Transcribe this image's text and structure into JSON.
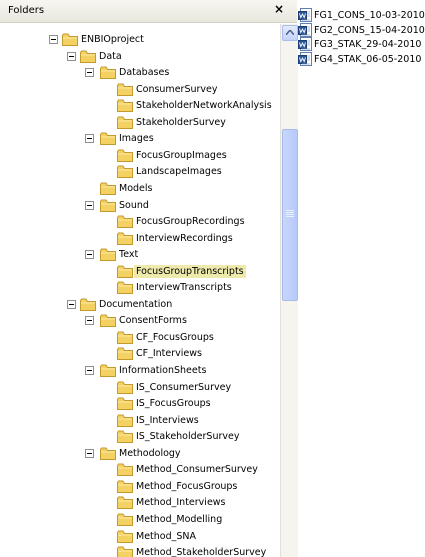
{
  "folders_pane": {
    "title": "Folders",
    "close_label": "×"
  },
  "tree": [
    {
      "label": "ENBIOproject",
      "depth": 0,
      "expanded": true
    },
    {
      "label": "Data",
      "depth": 1,
      "expanded": true
    },
    {
      "label": "Databases",
      "depth": 2,
      "expanded": true
    },
    {
      "label": "ConsumerSurvey",
      "depth": 3
    },
    {
      "label": "StakeholderNetworkAnalysis",
      "depth": 3
    },
    {
      "label": "StakeholderSurvey",
      "depth": 3
    },
    {
      "label": "Images",
      "depth": 2,
      "expanded": true
    },
    {
      "label": "FocusGroupImages",
      "depth": 3
    },
    {
      "label": "LandscapeImages",
      "depth": 3
    },
    {
      "label": "Models",
      "depth": 2
    },
    {
      "label": "Sound",
      "depth": 2,
      "expanded": true
    },
    {
      "label": "FocusGroupRecordings",
      "depth": 3
    },
    {
      "label": "InterviewRecordings",
      "depth": 3
    },
    {
      "label": "Text",
      "depth": 2,
      "expanded": true
    },
    {
      "label": "FocusGroupTranscripts",
      "depth": 3,
      "selected": true
    },
    {
      "label": "InterviewTranscripts",
      "depth": 3
    },
    {
      "label": "Documentation",
      "depth": 1,
      "expanded": true
    },
    {
      "label": "ConsentForms",
      "depth": 2,
      "expanded": true
    },
    {
      "label": "CF_FocusGroups",
      "depth": 3
    },
    {
      "label": "CF_Interviews",
      "depth": 3
    },
    {
      "label": "InformationSheets",
      "depth": 2,
      "expanded": true
    },
    {
      "label": "IS_ConsumerSurvey",
      "depth": 3
    },
    {
      "label": "IS_FocusGroups",
      "depth": 3
    },
    {
      "label": "IS_Interviews",
      "depth": 3
    },
    {
      "label": "IS_StakeholderSurvey",
      "depth": 3
    },
    {
      "label": "Methodology",
      "depth": 2,
      "expanded": true
    },
    {
      "label": "Method_ConsumerSurvey",
      "depth": 3
    },
    {
      "label": "Method_FocusGroups",
      "depth": 3
    },
    {
      "label": "Method_Interviews",
      "depth": 3
    },
    {
      "label": "Method_Modelling",
      "depth": 3
    },
    {
      "label": "Method_SNA",
      "depth": 3
    },
    {
      "label": "Method_StakeholderSurvey",
      "depth": 3
    }
  ],
  "files": [
    {
      "name": "FG1_CONS_10-03-2010"
    },
    {
      "name": "FG2_CONS_15-04-2010"
    },
    {
      "name": "FG3_STAK_29-04-2010"
    },
    {
      "name": "FG4_STAK_06-05-2010"
    }
  ],
  "colors": {
    "selection": "#eeeaab",
    "folder": "#f3d163",
    "scrollbar": "#c3d3fd"
  },
  "icons": {
    "tree_expander": "minus-box-icon",
    "folder": "folder-icon",
    "file": "word-document-icon"
  }
}
